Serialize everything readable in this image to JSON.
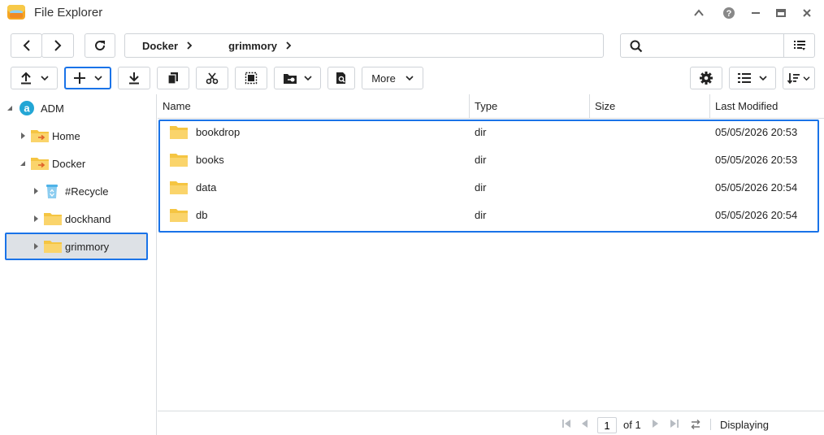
{
  "window": {
    "title": "File Explorer"
  },
  "nav": {
    "breadcrumb": [
      "Docker",
      "grimmory"
    ]
  },
  "search": {
    "placeholder": "",
    "value": ""
  },
  "toolbar": {
    "more_label": "More"
  },
  "tree": {
    "root": "ADM",
    "items": [
      {
        "label": "Home"
      },
      {
        "label": "Docker"
      },
      {
        "label": "#Recycle"
      },
      {
        "label": "dockhand"
      },
      {
        "label": "grimmory"
      }
    ]
  },
  "list": {
    "columns": [
      "Name",
      "Type",
      "Size",
      "Last Modified"
    ],
    "rows": [
      {
        "name": "bookdrop",
        "type": "dir",
        "size": "",
        "modified": "05/05/2026 20:53"
      },
      {
        "name": "books",
        "type": "dir",
        "size": "",
        "modified": "05/05/2026 20:53"
      },
      {
        "name": "data",
        "type": "dir",
        "size": "",
        "modified": "05/05/2026 20:54"
      },
      {
        "name": "db",
        "type": "dir",
        "size": "",
        "modified": "05/05/2026 20:54"
      }
    ]
  },
  "footer": {
    "page": "1",
    "of_label": "of 1",
    "displaying_label": "Displaying"
  },
  "colors": {
    "accent": "#1a73e8",
    "folder": "#f5c542",
    "selected_bg": "#dde1e6",
    "border": "#cfd3d8"
  }
}
